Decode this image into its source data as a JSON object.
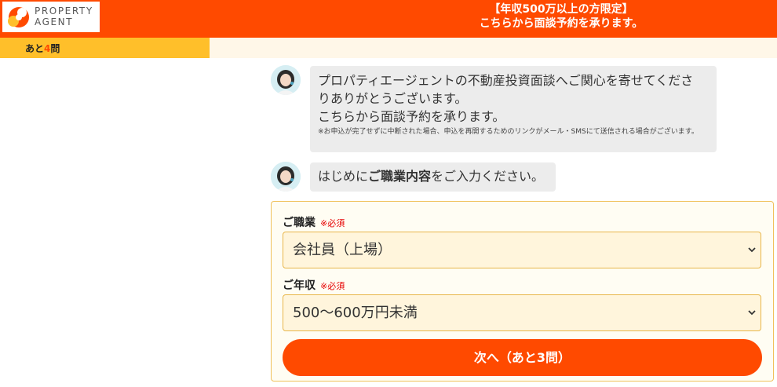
{
  "header": {
    "logo_line1": "PROPERTY",
    "logo_line2": "AGENT",
    "banner_line1": "【年収500万以上の方限定】",
    "banner_line2": "こちらから面談予約を承ります。"
  },
  "progress": {
    "prefix": "あと",
    "count": "4",
    "suffix": "問",
    "fill_fraction": 0.27
  },
  "chat": {
    "message1_line1": "プロパティエージェントの不動産投資面談へご関心を寄せてくださ",
    "message1_line2": "りありがとうございます。",
    "message1_line3": "こちらから面談予約を承ります。",
    "message1_note": "※お申込が完了せずに中断された場合、申込を再開するためのリンクがメール・SMSにて送信される場合がございます。",
    "message2_prefix": "はじめに",
    "message2_bold": "ご職業内容",
    "message2_suffix": "をご入力ください。"
  },
  "form": {
    "occupation_label": "ご職業",
    "occupation_required": "※必須",
    "occupation_value": "会社員（上場）",
    "income_label": "ご年収",
    "income_required": "※必須",
    "income_value": "500〜600万円未満",
    "next_button": "次へ（あと3問）"
  },
  "colors": {
    "brand_orange": "#ff4a00",
    "progress_yellow": "#ffbf2a",
    "required_red": "#e60000"
  }
}
